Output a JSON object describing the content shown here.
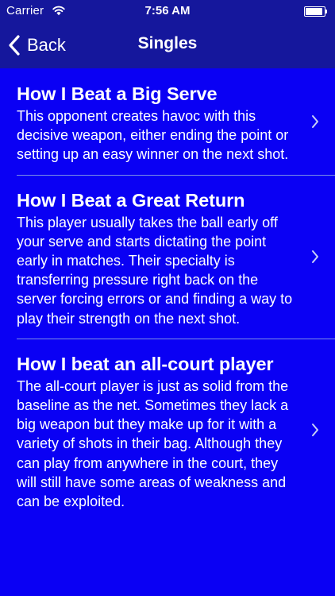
{
  "status_bar": {
    "carrier": "Carrier",
    "time": "7:56 AM"
  },
  "nav_bar": {
    "back_label": "Back",
    "title": "Singles"
  },
  "rows": [
    {
      "title": "How I Beat a Big Serve",
      "description": "This opponent creates havoc with this decisive weapon, either ending the point or setting up an easy winner on the next shot."
    },
    {
      "title": "How I Beat a Great Return",
      "description": "This player usually takes the ball early off your serve and starts dictating the point early in matches. Their specialty is transferring pressure right back on the server forcing errors or and finding a way to play their strength on the next shot."
    },
    {
      "title": "How I beat an all-court player",
      "description": "The all-court player is just as solid from the baseline as the net. Sometimes they lack a big weapon but they make up for it with a variety of shots in their bag. Although they can play from anywhere in the court, they will still have some areas of weakness and can be exploited."
    }
  ],
  "colors": {
    "background": "#0a00f4",
    "nav_background": "#15179c",
    "text": "#ffffff",
    "separator": "#7e8fe6"
  },
  "icons": [
    "wifi-icon",
    "battery-icon",
    "back-chevron-icon",
    "disclosure-chevron-icon"
  ]
}
